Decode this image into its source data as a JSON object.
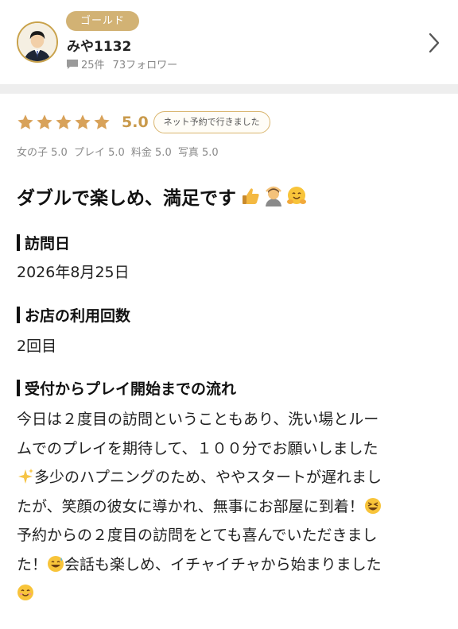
{
  "reviewer": {
    "rank": "ゴールド",
    "name": "みや1132",
    "posts": "25件",
    "followers": "73フォロワー"
  },
  "rating": {
    "stars": 5,
    "score": "5.0",
    "badge": "ネット予約で行きました"
  },
  "subscores": [
    "女の子 5.0",
    "プレイ 5.0",
    "料金 5.0",
    "写真 5.0"
  ],
  "review": {
    "title": "ダブルで楽しめ、満足です"
  },
  "sections": {
    "visit_date": {
      "heading": "訪問日",
      "value": "2026年8月25日"
    },
    "visit_count": {
      "heading": "お店の利用回数",
      "value": "2回目"
    },
    "flow": {
      "heading": "受付からプレイ開始までの流れ",
      "lines": [
        "今日は２度目の訪問ということもあり、洗い場とルー",
        "ムでのプレイを期待して、１００分でお願いしました",
        "多少のハプニングのため、ややスタートが遅れまし",
        "たが、笑顔の彼女に導かれ、無事にお部屋に到着！",
        "予約からの２度目の訪問をとても喜んでいただきまし",
        "た！",
        "会話も楽しめ、イチャイチャから始まりました"
      ]
    }
  },
  "icons": {
    "avatar": "user-avatar",
    "message": "message-icon",
    "chevron": "chevron-right-icon",
    "title_emojis": [
      "thumbs-up-emoji",
      "person-gesturing-ok-emoji",
      "hugging-face-emoji"
    ],
    "inline_emojis": [
      "sparkles-emoji",
      "grinning-squinting-emoji",
      "grinning-sweat-emoji",
      "smiling-face-emoji"
    ]
  },
  "colors": {
    "gold": "#d2b274",
    "star": "#d8a25a",
    "score": "#c99a4c",
    "divider": "#eeeeee"
  }
}
